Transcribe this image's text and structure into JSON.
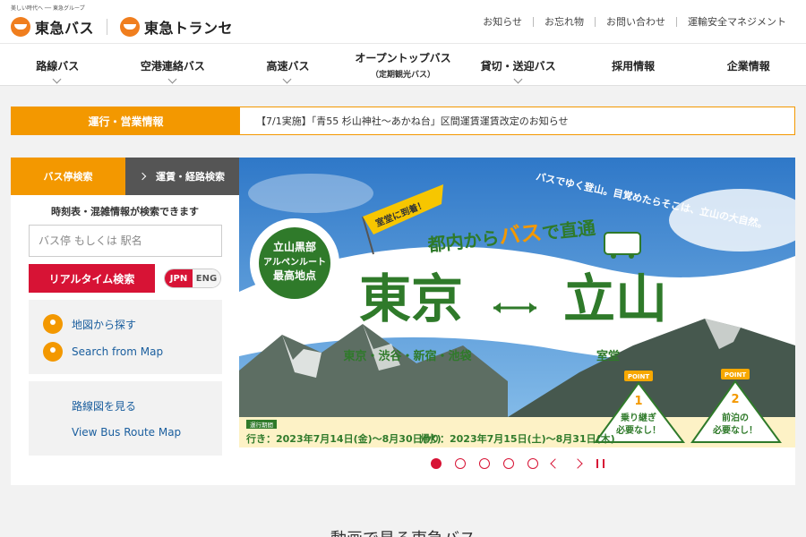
{
  "header": {
    "tagline": "美しい時代へ ── 東急グループ",
    "logo_bus": "東急バス",
    "logo_transe": "東急トランセ",
    "utility_links": [
      "お知らせ",
      "お忘れ物",
      "お問い合わせ",
      "運輸安全マネジメント"
    ]
  },
  "nav": {
    "items": [
      {
        "label": "路線バス"
      },
      {
        "label": "空港連絡バス"
      },
      {
        "label": "高速バス"
      },
      {
        "label": "オープントップバス",
        "sub": "（定期観光バス）"
      },
      {
        "label": "貸切・送迎バス"
      },
      {
        "label": "採用情報"
      },
      {
        "label": "企業情報"
      }
    ]
  },
  "news": {
    "label": "運行・営業情報",
    "text": "【7/1実施】「青55 杉山神社～あかね台」区間運賃運賃改定のお知らせ"
  },
  "search": {
    "tab_active": "バス停検索",
    "tab_inactive": "運賃・経路検索",
    "caption": "時刻表・混雑情報が検索できます",
    "placeholder": "バス停 もしくは 駅名",
    "realtime_button": "リアルタイム検索",
    "lang_jpn": "JPN",
    "lang_eng": "ENG",
    "map_links": [
      "地図から探す",
      "Search from Map"
    ],
    "route_links": [
      "路線図を見る",
      "View Bus Route Map"
    ]
  },
  "banner": {
    "badge_lines": [
      "立山黒部",
      "アルペンルート",
      "最高地点"
    ],
    "flag_text": "室堂に到着！",
    "slogan": "バスでゆく登山。目覚めたらそこは、立山の大自然。",
    "subtitle_pre": "都内から",
    "subtitle_bus": "バス",
    "subtitle_post": "で直通",
    "title_left": "東京",
    "title_right": "立山",
    "origins": "東京・渋谷・新宿・池袋",
    "destination": "室堂",
    "point_label": "POINT",
    "point1_number": "1",
    "point1_lines": [
      "乗り継ぎ",
      "必要なし！"
    ],
    "point2_number": "2",
    "point2_lines": [
      "前泊の",
      "必要なし！"
    ],
    "period_tag": "運行期間",
    "outbound": "行き：2023年7月14日(金)〜8月30日(水)",
    "return": "帰り：2023年7月15日(土)〜8月31日(木)"
  },
  "carousel": {
    "slide_count": 5,
    "active_index": 0
  },
  "section_heading": "動画で見る東急バス",
  "colors": {
    "accent_orange": "#f39800",
    "accent_red": "#d71335",
    "banner_green": "#2f7a2a",
    "link_blue": "#1a5e9e"
  }
}
